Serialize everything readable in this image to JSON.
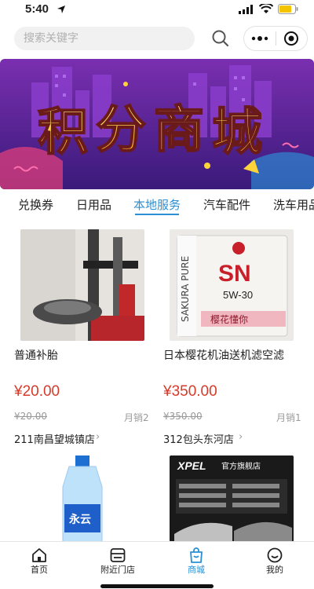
{
  "status_bar": {
    "time": "5:40",
    "location_icon": "location-arrow-icon",
    "signal_icon": "signal-icon",
    "wifi_icon": "wifi-icon",
    "battery_icon": "battery-icon"
  },
  "search": {
    "placeholder": "搜索关键字",
    "button_icon": "search-icon"
  },
  "capsule": {
    "more_icon": "more-dots-icon",
    "close_icon": "close-target-icon"
  },
  "banner": {
    "title_chars": [
      "积",
      "分",
      "商",
      "城"
    ]
  },
  "tabs": [
    {
      "label": "兑换券",
      "active": false
    },
    {
      "label": "日用品",
      "active": false
    },
    {
      "label": "本地服务",
      "active": true
    },
    {
      "label": "汽车配件",
      "active": false
    },
    {
      "label": "洗车用品",
      "active": false
    }
  ],
  "products": [
    {
      "name": "普通补胎",
      "price": "¥20.00",
      "original_price": "¥20.00",
      "sales": "月销2",
      "store": "211南昌望城镇店"
    },
    {
      "name": "日本樱花机油送机滤空滤",
      "price": "¥350.00",
      "original_price": "¥350.00",
      "sales": "月销1",
      "store": "312包头东河店",
      "image_text": {
        "brand": "SN",
        "grade": "5W-30",
        "vertical": "SAKURA PURE",
        "label": "樱花懂你"
      }
    },
    {
      "name": "",
      "image_text": {
        "brand": "永云"
      }
    },
    {
      "name": "",
      "image_text": {
        "brand": "XPEL",
        "subtitle": "官方旗舰店"
      }
    }
  ],
  "bottom_nav": [
    {
      "label": "首页",
      "icon": "home-icon",
      "active": false
    },
    {
      "label": "附近门店",
      "icon": "store-icon",
      "active": false
    },
    {
      "label": "商城",
      "icon": "shopping-bag-icon",
      "active": true
    },
    {
      "label": "我的",
      "icon": "smile-user-icon",
      "active": false
    }
  ],
  "colors": {
    "accent": "#2a8fd4",
    "price": "#d83a2a",
    "banner_bg": "#5a1f95",
    "banner_text": "#ffd43a"
  }
}
